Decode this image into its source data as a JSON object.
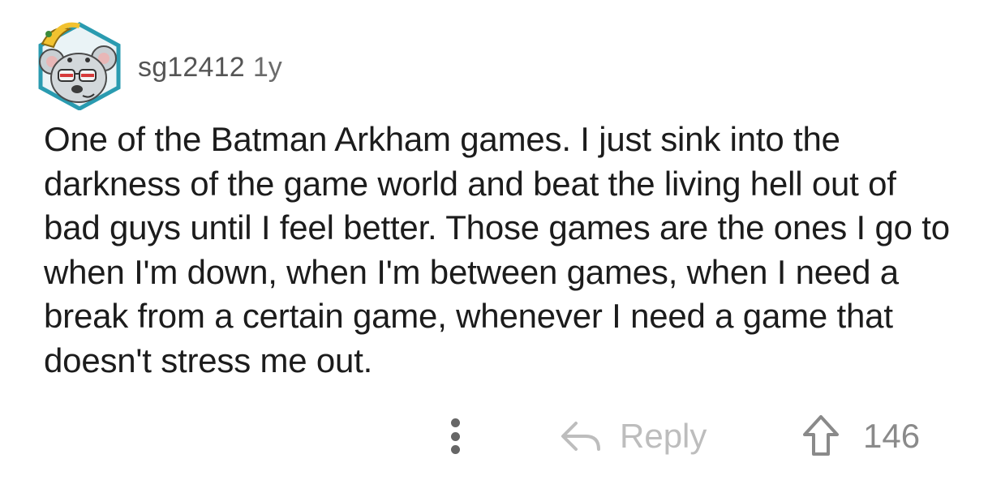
{
  "comment": {
    "username": "sg12412",
    "age": "1y",
    "avatar_icon": "koala-avatar-icon",
    "body": "One of the Batman Arkham games. I just sink into the darkness of the game world and beat the living hell out of bad guys until I feel better. Those games are the ones I go to when I'm down, when I'm between games, when I need a break from a certain game, whenever I need a game that doesn't stress me out.",
    "actions": {
      "more_icon": "vertical-dots-icon",
      "reply_icon": "reply-arrow-icon",
      "reply_label": "Reply",
      "upvote_icon": "upvote-arrow-icon",
      "score": "146"
    }
  },
  "colors": {
    "username": "#555555",
    "body_text": "#1c1c1c",
    "reply_label": "#bdbdbd",
    "score": "#8a8a8a",
    "avatar_border": "#2a9bb0"
  }
}
